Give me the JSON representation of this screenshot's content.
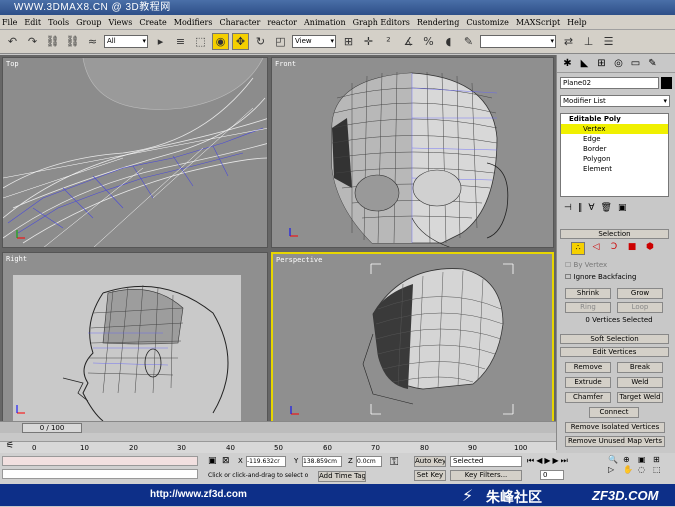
{
  "title_bar": {
    "text": "WWW.3DMAX8.CN @ 3D教程网"
  },
  "menu": [
    "File",
    "Edit",
    "Tools",
    "Group",
    "Views",
    "Create",
    "Modifiers",
    "Character",
    "reactor",
    "Animation",
    "Graph Editors",
    "Rendering",
    "Customize",
    "MAXScript",
    "Help"
  ],
  "toolbar": {
    "selection_filter": "All",
    "ref_coord": "View"
  },
  "viewports": {
    "top": "Top",
    "front": "Front",
    "right": "Right",
    "perspective": "Perspective"
  },
  "command_panel": {
    "object_name": "Plane02",
    "modifier_list": "Modifier List",
    "stack": {
      "root": "Editable Poly",
      "items": [
        "Vertex",
        "Edge",
        "Border",
        "Polygon",
        "Element"
      ],
      "selected": "Vertex"
    },
    "selection": {
      "title": "Selection",
      "by_vertex": "By Vertex",
      "ignore_backfacing": "Ignore Backfacing",
      "shrink": "Shrink",
      "grow": "Grow",
      "ring": "Ring",
      "loop": "Loop",
      "status": "0 Vertices Selected"
    },
    "soft_selection": "Soft Selection",
    "edit_vertices": {
      "title": "Edit Vertices",
      "remove": "Remove",
      "break": "Break",
      "extrude": "Extrude",
      "weld": "Weld",
      "chamfer": "Chamfer",
      "target_weld": "Target Weld",
      "connect": "Connect",
      "remove_isolated": "Remove Isolated Vertices",
      "remove_unused": "Remove Unused Map Verts"
    }
  },
  "time_slider": {
    "label": "0 / 100"
  },
  "timeline_ticks": [
    "0",
    "10",
    "20",
    "30",
    "40",
    "50",
    "60",
    "70",
    "80",
    "90",
    "100"
  ],
  "status": {
    "x": "-119.632cr",
    "y": "138.859cm",
    "z": "0.0cm",
    "x_label": "X",
    "y_label": "Y",
    "z_label": "Z",
    "prompt": "Click or click-and-drag to select o",
    "add_time_tag": "Add Time Tag",
    "auto_key": "Auto Key",
    "set_key": "Set Key",
    "key_mode": "Selected",
    "key_filters": "Key Filters...",
    "frame": "0"
  },
  "banner": {
    "left": "http://www.zf3d.com",
    "middle": "朱峰社区",
    "right": "ZF3D.COM"
  },
  "colors": {
    "accent_yellow": "#f0f000",
    "banner_blue": "#0d2f88",
    "title_blue": "#2d4f88"
  }
}
